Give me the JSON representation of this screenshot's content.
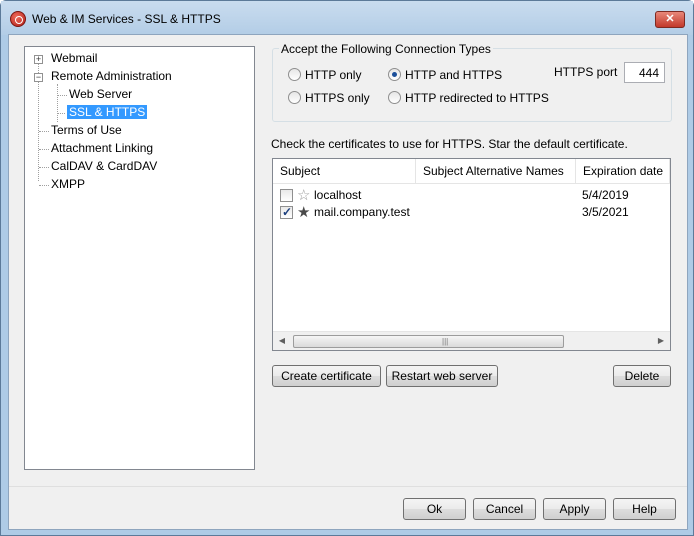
{
  "window": {
    "title": "Web & IM Services - SSL & HTTPS",
    "close_label": "✕"
  },
  "tree": {
    "items": [
      {
        "label": "Webmail",
        "expander": "+"
      },
      {
        "label": "Remote Administration",
        "expander": "−"
      },
      {
        "label": "Web Server"
      },
      {
        "label": "SSL & HTTPS",
        "selected": true
      },
      {
        "label": "Terms of Use"
      },
      {
        "label": "Attachment Linking"
      },
      {
        "label": "CalDAV & CardDAV"
      },
      {
        "label": "XMPP"
      }
    ]
  },
  "connection_types": {
    "title": "Accept the Following Connection Types",
    "options": [
      {
        "label": "HTTP only",
        "checked": false
      },
      {
        "label": "HTTP and HTTPS",
        "checked": true
      },
      {
        "label": "HTTPS only",
        "checked": false
      },
      {
        "label": "HTTP redirected to HTTPS",
        "checked": false
      }
    ],
    "port_label": "HTTPS port",
    "port_value": "444"
  },
  "certificates": {
    "instruction": "Check the certificates to use for HTTPS.  Star the default certificate.",
    "columns": [
      "Subject",
      "Subject Alternative Names",
      "Expiration date"
    ],
    "rows": [
      {
        "subject": "localhost",
        "alt_names": "",
        "expiration": "5/4/2019",
        "checked": false,
        "starred": false
      },
      {
        "subject": "mail.company.test",
        "alt_names": "",
        "expiration": "3/5/2021",
        "checked": true,
        "starred": true
      }
    ],
    "scroll_left": "◀",
    "scroll_right": "▶",
    "scroll_grip": "|||"
  },
  "actions": {
    "create_certificate": "Create certificate",
    "restart_web_server": "Restart web server",
    "delete": "Delete"
  },
  "footer": {
    "ok": "Ok",
    "cancel": "Cancel",
    "apply": "Apply",
    "help": "Help"
  }
}
